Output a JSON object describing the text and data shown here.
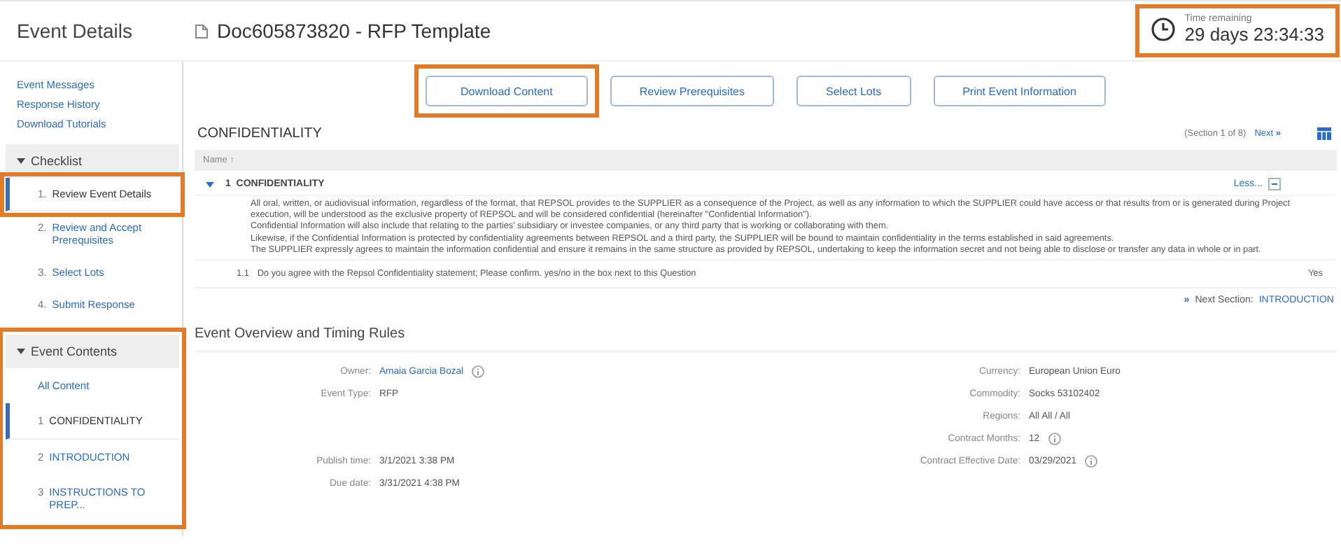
{
  "header": {
    "title": "Event Details",
    "document": "Doc605873820 - RFP Template",
    "timer": {
      "label": "Time remaining",
      "value": "29 days 23:34:33",
      "highlighted": true
    }
  },
  "sidebar": {
    "links": [
      "Event Messages",
      "Response History",
      "Download Tutorials"
    ],
    "checklist": {
      "title": "Checklist",
      "expanded": true,
      "items": [
        {
          "number": "1.",
          "label": "Review Event Details",
          "selected": true,
          "highlighted": true
        },
        {
          "number": "2.",
          "label": "Review and Accept Prerequisites",
          "selected": false,
          "highlighted": false
        },
        {
          "number": "3.",
          "label": "Select Lots",
          "selected": false,
          "highlighted": false
        },
        {
          "number": "4.",
          "label": "Submit Response",
          "selected": false,
          "highlighted": false
        }
      ]
    },
    "contents": {
      "title": "Event Contents",
      "expanded": true,
      "highlighted": true,
      "items": [
        {
          "label": "All Content",
          "selected": false,
          "highlighted": false
        },
        {
          "number": "1",
          "label": "CONFIDENTIALITY",
          "selected": true,
          "highlighted": false
        },
        {
          "number": "2",
          "label": "INTRODUCTION",
          "selected": false,
          "highlighted": false
        },
        {
          "number": "3",
          "label": "INSTRUCTIONS TO PREP...",
          "selected": false,
          "highlighted": false
        }
      ]
    }
  },
  "buttons": [
    {
      "label": "Download Content",
      "highlighted": true
    },
    {
      "label": "Review Prerequisites",
      "highlighted": false
    },
    {
      "label": "Select Lots",
      "highlighted": false
    },
    {
      "label": "Print Event Information",
      "highlighted": false
    }
  ],
  "section": {
    "title": "CONFIDENTIALITY",
    "position": "(Section 1 of 8)",
    "next": "Next",
    "next_icon": "»",
    "column": "Name ↑",
    "group": {
      "number": "1",
      "title": "CONFIDENTIALITY",
      "expanded": true,
      "less": "Less...",
      "paragraphs": [
        "All oral, written, or audiovisual information, regardless of the format, that REPSOL provides to the SUPPLIER as a consequence of the Project, as well as any information to which the SUPPLIER could have access or that results from or is generated during Project execution, will be understood as the exclusive property of REPSOL and will be considered confidential (hereinafter \"Confidential Information\").",
        "Confidential Information will also include that relating to the parties' subsidiary or investee companies, or any third party that is working or collaborating with them.",
        "Likewise, if the Confidential Information is protected by confidentiality agreements between REPSOL and a third party, the SUPPLIER will be bound to maintain confidentiality in the terms established in said agreements.",
        "The SUPPLIER expressly agrees to maintain the information confidential and ensure it remains in the same structure as provided by REPSOL, undertaking to keep the information secret and not being able to disclose or transfer any data in whole or in part."
      ],
      "question": {
        "number": "1.1",
        "text": "Do you agree with the Repsol Confidentiality statement; Please confirm. yes/no in the box next to this Question",
        "answer": "Yes"
      }
    },
    "next_section_label": "Next Section:",
    "next_section": "INTRODUCTION"
  },
  "overview": {
    "title": "Event Overview and Timing Rules",
    "left": [
      {
        "label": "Owner:",
        "value": "Amaia Garcia Bozal",
        "kind": "link",
        "info": true
      },
      {
        "label": "Event Type:",
        "value": "RFP",
        "kind": "text",
        "info": false
      }
    ],
    "timing": [
      {
        "label": "Publish time:",
        "value": "3/1/2021 3:38 PM",
        "kind": "text",
        "info": false
      },
      {
        "label": "Due date:",
        "value": "3/31/2021 4:38 PM",
        "kind": "text",
        "info": false
      }
    ],
    "right": [
      {
        "label": "Currency:",
        "value": "European Union Euro",
        "kind": "text",
        "info": false
      },
      {
        "label": "Commodity:",
        "value": "Socks 53102402",
        "kind": "text",
        "info": false
      },
      {
        "label": "Regions:",
        "value": "All All / All",
        "kind": "text",
        "info": false
      },
      {
        "label": "Contract Months:",
        "value": "12",
        "kind": "text",
        "info": true
      },
      {
        "label": "Contract Effective Date:",
        "value": "03/29/2021",
        "kind": "text",
        "info": true
      }
    ]
  }
}
